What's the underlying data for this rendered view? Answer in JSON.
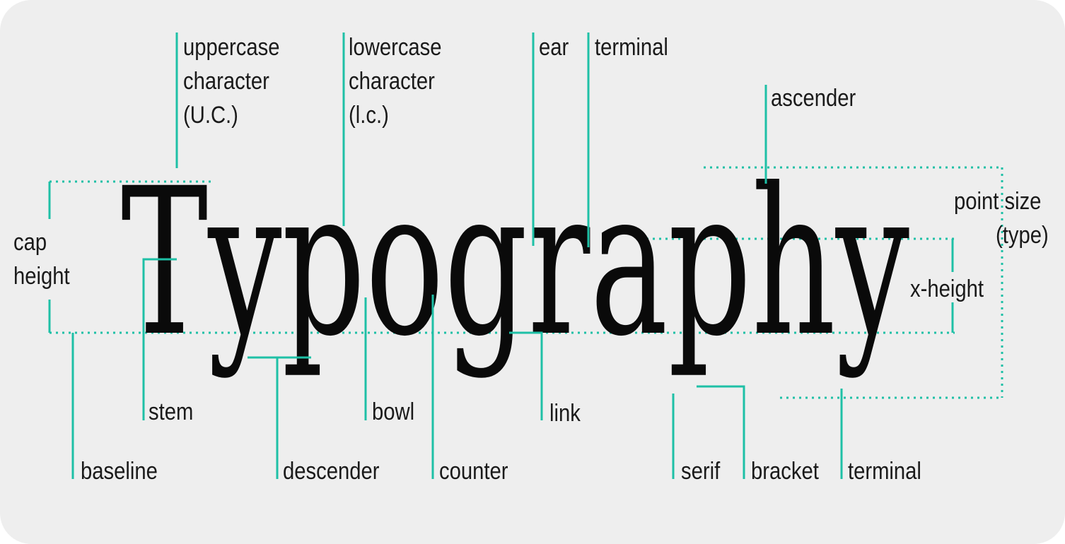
{
  "word": "Typography",
  "accent_color": "#1ec0a6",
  "background_color": "#eeeeee",
  "text_color": "#1a1a1a",
  "labels": {
    "uppercase_line1": "uppercase",
    "uppercase_line2": "character",
    "uppercase_line3": "(U.C.)",
    "lowercase_line1": "lowercase",
    "lowercase_line2": "character",
    "lowercase_line3": "(l.c.)",
    "ear": "ear",
    "terminal_top": "terminal",
    "ascender": "ascender",
    "point_size_line1": "point size",
    "point_size_line2": "(type)",
    "cap_height_line1": "cap",
    "cap_height_line2": "height",
    "x_height": "x-height",
    "stem": "stem",
    "bowl": "bowl",
    "link": "link",
    "baseline": "baseline",
    "descender": "descender",
    "counter": "counter",
    "serif": "serif",
    "bracket": "bracket",
    "terminal_bottom": "terminal"
  }
}
